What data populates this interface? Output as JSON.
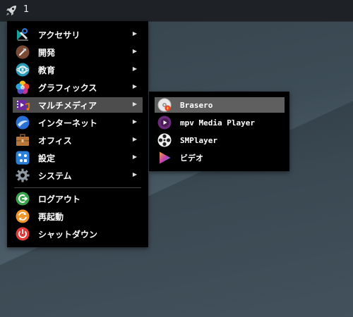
{
  "panel": {
    "workspace_number": "1",
    "launcher_icon": "rocket-icon"
  },
  "menu": {
    "items": [
      {
        "label": "アクセサリ",
        "icon": "accessories-icon",
        "has_submenu": true
      },
      {
        "label": "開発",
        "icon": "development-icon",
        "has_submenu": true
      },
      {
        "label": "教育",
        "icon": "education-icon",
        "has_submenu": true
      },
      {
        "label": "グラフィックス",
        "icon": "graphics-icon",
        "has_submenu": true
      },
      {
        "label": "マルチメディア",
        "icon": "multimedia-icon",
        "has_submenu": true,
        "active": true
      },
      {
        "label": "インターネット",
        "icon": "internet-icon",
        "has_submenu": true
      },
      {
        "label": "オフィス",
        "icon": "office-icon",
        "has_submenu": true
      },
      {
        "label": "設定",
        "icon": "settings-icon",
        "has_submenu": true
      },
      {
        "label": "システム",
        "icon": "system-icon",
        "has_submenu": true
      }
    ],
    "actions": [
      {
        "label": "ログアウト",
        "icon": "logout-icon"
      },
      {
        "label": "再起動",
        "icon": "restart-icon"
      },
      {
        "label": "シャットダウン",
        "icon": "shutdown-icon"
      }
    ],
    "arrow_glyph": "▶"
  },
  "submenu": {
    "items": [
      {
        "label": "Brasero",
        "icon": "brasero-icon",
        "active": true
      },
      {
        "label": "mpv Media Player",
        "icon": "mpv-icon"
      },
      {
        "label": "SMPlayer",
        "icon": "smplayer-icon"
      },
      {
        "label": "ビデオ",
        "icon": "video-icon"
      }
    ]
  },
  "colors": {
    "panel": "#1e2226",
    "menu_bg": "#000000",
    "highlight": "#4d4d4d",
    "submenu_highlight": "#5f5f5f"
  }
}
